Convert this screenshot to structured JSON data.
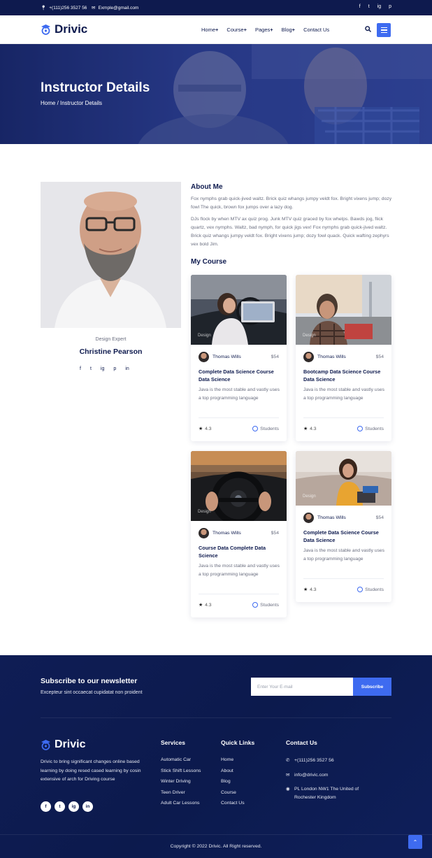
{
  "topbar": {
    "phone": "+(111)256 3527 56",
    "email": "Exmple@gmail.com",
    "socials": [
      "f",
      "t",
      "ig",
      "p"
    ]
  },
  "header": {
    "brand": "Drivic",
    "nav": [
      "Home",
      "Course",
      "Pages",
      "Blog",
      "Contact Us"
    ],
    "nav_plus": [
      "+",
      "+",
      "+",
      "+",
      ""
    ]
  },
  "banner": {
    "title": "Instructor Details",
    "breadcrumb": "Home / Instructor Details"
  },
  "instructor": {
    "role": "Design Expert",
    "name": "Christine Pearson",
    "socials": [
      "f",
      "t",
      "ig",
      "p",
      "in"
    ]
  },
  "about": {
    "title": "About Me",
    "p1": "Fox nymphs grab quick-jived waltz. Brick quiz whangs jumpy veldt fox. Bright vixens jump; dozy fowl The quick, brown fox jumps over a lazy dog.",
    "p2": "DJs flock by when MTV ax quiz prog. Junk MTV quiz graced by fox whelps. Bawds jog, flick quartz, vex nymphs. Waltz, bad nymph, for quick jigs vex! Fox nymphs grab quick-jived waltz. Brick quiz whangs jumpy veldt fox. Bright vixens jump; dozy fowl quack. Quick wafting zephyrs vex bold Jim."
  },
  "my_course": {
    "title": "My Course",
    "cards": [
      {
        "tag": "Design",
        "author": "Thomas Wills",
        "price": "$54",
        "title": "Complete Data Science Course Data Science",
        "desc": "Java is the most stable and vastly uses a top programming language",
        "rating": "4.3",
        "students": "Students"
      },
      {
        "tag": "Design",
        "author": "Thomas Wills",
        "price": "$54",
        "title": "Bootcamp Data Science Course Data Science",
        "desc": "Java is the most stable and vastly uses a top programming language",
        "rating": "4.3",
        "students": "Students"
      },
      {
        "tag": "Design",
        "author": "Thomas Wills",
        "price": "$54",
        "title": "Course Data Complete Data Science",
        "desc": "Java is the most stable and vastly uses a top programming language",
        "rating": "4.3",
        "students": "Students"
      },
      {
        "tag": "Design",
        "author": "Thomas Wills",
        "price": "$54",
        "title": "Complete Data Science Course Data Science",
        "desc": "Java is the most stable and vastly uses a top programming language",
        "rating": "4.3",
        "students": "Students"
      }
    ]
  },
  "newsletter": {
    "title": "Subscribe to our newsletter",
    "subtitle": "Excepteur sint occaecat cupidatat non proident",
    "placeholder": "Enter Your E-mail",
    "button": "Subscribe"
  },
  "footer": {
    "brand": "Drivic",
    "description": "Drivic to bring significant changes online based learning by doing resed cased learning by cosin extensive of arch for Driving course",
    "socials": [
      "f",
      "t",
      "ig",
      "in"
    ],
    "services": {
      "title": "Services",
      "items": [
        "Automatic Car",
        "Stick Shift Lessons",
        "Winter Driving",
        "Teen Driver",
        "Adult Car Lessons"
      ]
    },
    "quick_links": {
      "title": "Quick Links",
      "items": [
        "Home",
        "About",
        "Blog",
        "Course",
        "Contact Us"
      ]
    },
    "contact": {
      "title": "Contact Us",
      "phone": "+(111)256 3527 56",
      "email": "info@drivic.com",
      "address_1": "PL London NW1 The United of",
      "address_2": "Rochester Kingdom"
    },
    "copyright": "Copyright © 2022 Drivic. All Right reserved."
  },
  "colors": {
    "navy": "#0e1a4e",
    "accent": "#3e6bf0"
  }
}
